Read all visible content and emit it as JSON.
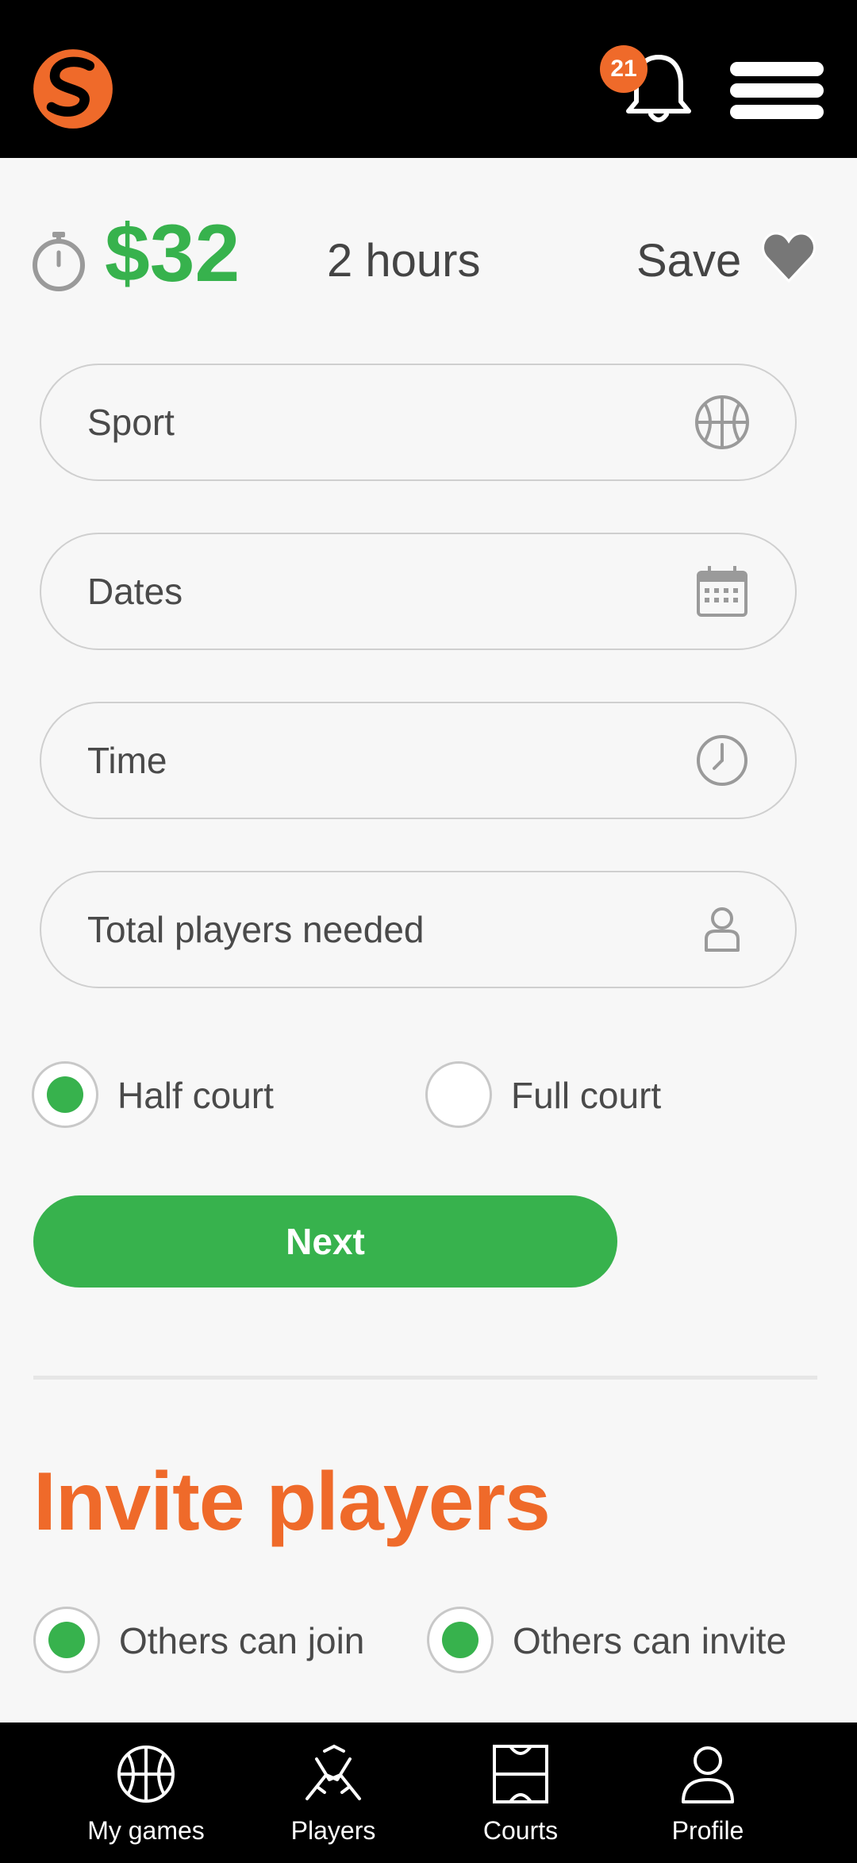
{
  "header": {
    "notification_count": "21"
  },
  "summary": {
    "price": "$32",
    "duration": "2 hours",
    "save_label": "Save"
  },
  "form": {
    "sport_placeholder": "Sport",
    "dates_placeholder": "Dates",
    "time_placeholder": "Time",
    "players_placeholder": "Total players needed",
    "court_options": [
      {
        "label": "Half court",
        "selected": true
      },
      {
        "label": "Full court",
        "selected": false
      }
    ],
    "next_label": "Next"
  },
  "invite": {
    "title": "Invite players",
    "options": [
      {
        "label": "Others can join",
        "selected": true
      },
      {
        "label": "Others can invite",
        "selected": true
      }
    ]
  },
  "bottom_nav": {
    "items": [
      {
        "label": "My games",
        "icon": "basketball-icon"
      },
      {
        "label": "Players",
        "icon": "handshake-icon"
      },
      {
        "label": "Courts",
        "icon": "court-icon"
      },
      {
        "label": "Profile",
        "icon": "person-icon"
      }
    ]
  },
  "colors": {
    "brand_orange": "#ef6a2a",
    "accent_green": "#37b24d",
    "bar_black": "#000000"
  }
}
